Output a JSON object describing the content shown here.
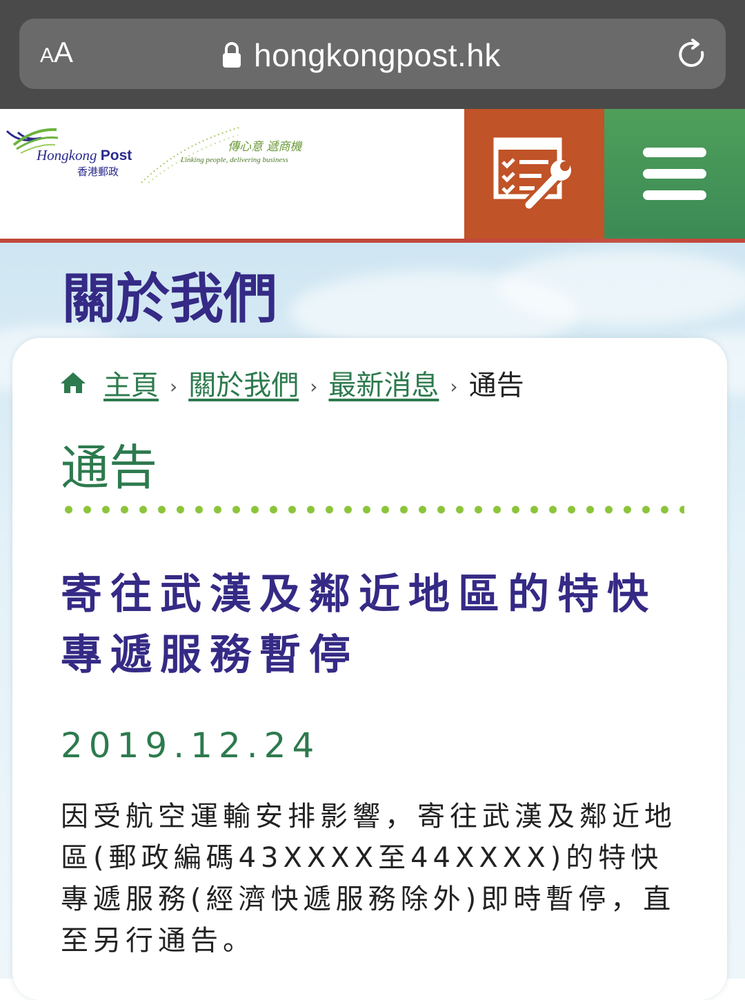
{
  "browser": {
    "text_size_label_small": "A",
    "text_size_label_big": "A",
    "url": "hongkongpost.hk"
  },
  "site": {
    "logo_name_en_italic": "Hongkong",
    "logo_name_en_bold": "Post",
    "logo_name_zh": "香港郵政",
    "slogan_zh": "傳心意 遞商機",
    "slogan_en": "Linking people, delivering business"
  },
  "section": {
    "title": "關於我們"
  },
  "breadcrumb": {
    "items": [
      "主頁",
      "關於我們",
      "最新消息"
    ],
    "separator": "›",
    "current": "通告"
  },
  "page": {
    "heading": "通告"
  },
  "notice": {
    "title": "寄往武漢及鄰近地區的特快專遞服務暫停",
    "date": "2019.12.24",
    "body": "因受航空運輸安排影響，寄往武漢及鄰近地區(郵政編碼43XXXX至44XXXX)的特快專遞服務(經濟快遞服務除外)即時暫停，直至另行通告。"
  },
  "colors": {
    "brand_purple": "#352a85",
    "brand_green": "#2d7a4e",
    "tools_orange": "#c05327",
    "menu_green": "#3b8a56",
    "accent_red": "#c2483a",
    "dot_green": "#8cc43a"
  },
  "icons": {
    "lock": "lock-icon",
    "reload": "reload-icon",
    "tools": "checklist-wrench-icon",
    "menu": "hamburger-menu-icon",
    "home": "home-icon"
  }
}
